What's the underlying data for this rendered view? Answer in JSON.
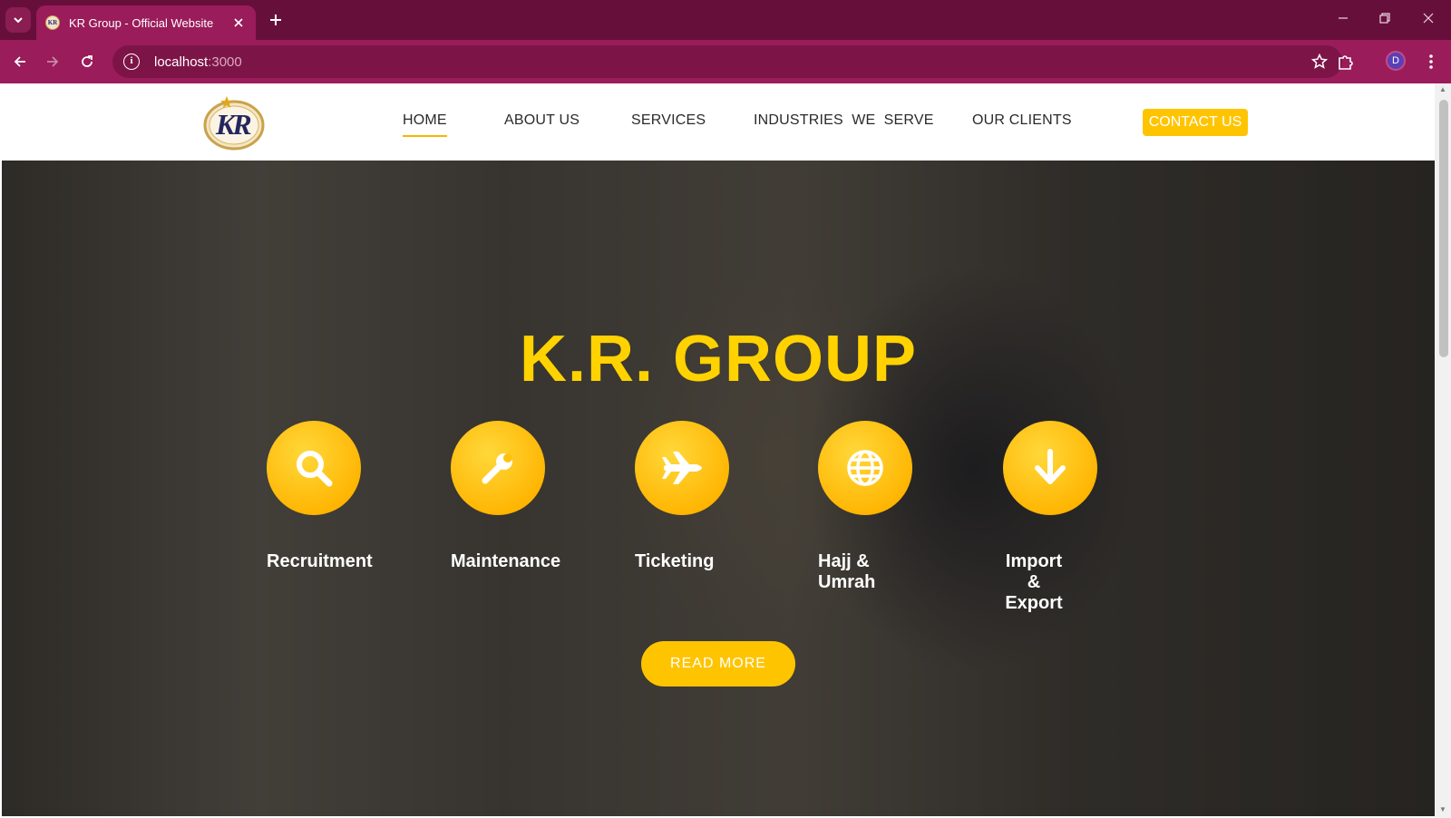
{
  "browser": {
    "tab_title": "KR Group - Official Website",
    "url_host": "localhost",
    "url_port": ":3000",
    "profile_initial": "D"
  },
  "site": {
    "logo_letters": "KR",
    "nav": [
      {
        "label": "HOME",
        "active": true
      },
      {
        "label": "ABOUT US"
      },
      {
        "label": "SERVICES"
      },
      {
        "label": "INDUSTRIES  WE  SERVE"
      },
      {
        "label": "OUR CLIENTS"
      }
    ],
    "contact_label": "CONTACT US"
  },
  "hero": {
    "title": "K.R. GROUP",
    "services": [
      {
        "label": "Recruitment",
        "icon": "search-icon"
      },
      {
        "label": "Maintenance",
        "icon": "wrench-icon"
      },
      {
        "label": "Ticketing",
        "icon": "airplane-icon"
      },
      {
        "label": "Hajj &\nUmrah",
        "icon": "globe-icon"
      },
      {
        "label": "Import\n&\nExport",
        "icon": "arrow-down-icon"
      }
    ],
    "read_more": "READ MORE"
  },
  "colors": {
    "browser_frame": "#670f3b",
    "toolbar": "#9a1c5a",
    "accent_yellow": "#ffc400",
    "title_yellow": "#ffd200"
  }
}
